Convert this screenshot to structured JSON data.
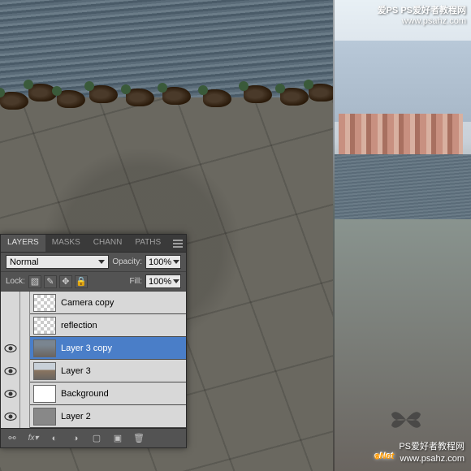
{
  "watermark": {
    "top_brand": "爱PS",
    "top_title": "PS爱好者教程网",
    "top_url": "www.psahz.com",
    "bottom_logo_e": "e",
    "bottom_logo_rest": "Net",
    "bottom_title": "PS爱好者教程网",
    "bottom_url": "www.psahz.com"
  },
  "panel": {
    "tabs": {
      "layers": "LAYERS",
      "masks": "MASKS",
      "channels": "CHANN",
      "paths": "PATHS"
    },
    "blend_mode": "Normal",
    "opacity_label": "Opacity:",
    "opacity_value": "100%",
    "lock_label": "Lock:",
    "fill_label": "Fill:",
    "fill_value": "100%",
    "layers": [
      {
        "name": "Camera copy",
        "visible": false,
        "thumb": "trans",
        "selected": false
      },
      {
        "name": "reflection",
        "visible": false,
        "thumb": "trans",
        "selected": false
      },
      {
        "name": "Layer 3 copy",
        "visible": true,
        "thumb": "pave",
        "selected": true
      },
      {
        "name": "Layer 3",
        "visible": true,
        "thumb": "city",
        "selected": false
      },
      {
        "name": "Background",
        "visible": true,
        "thumb": "white",
        "selected": false
      },
      {
        "name": "Layer 2",
        "visible": true,
        "thumb": "gray",
        "selected": false
      }
    ],
    "footer_icons": [
      "link-icon",
      "fx-icon",
      "mask-icon",
      "adjustment-icon",
      "group-icon",
      "new-layer-icon",
      "trash-icon"
    ]
  }
}
